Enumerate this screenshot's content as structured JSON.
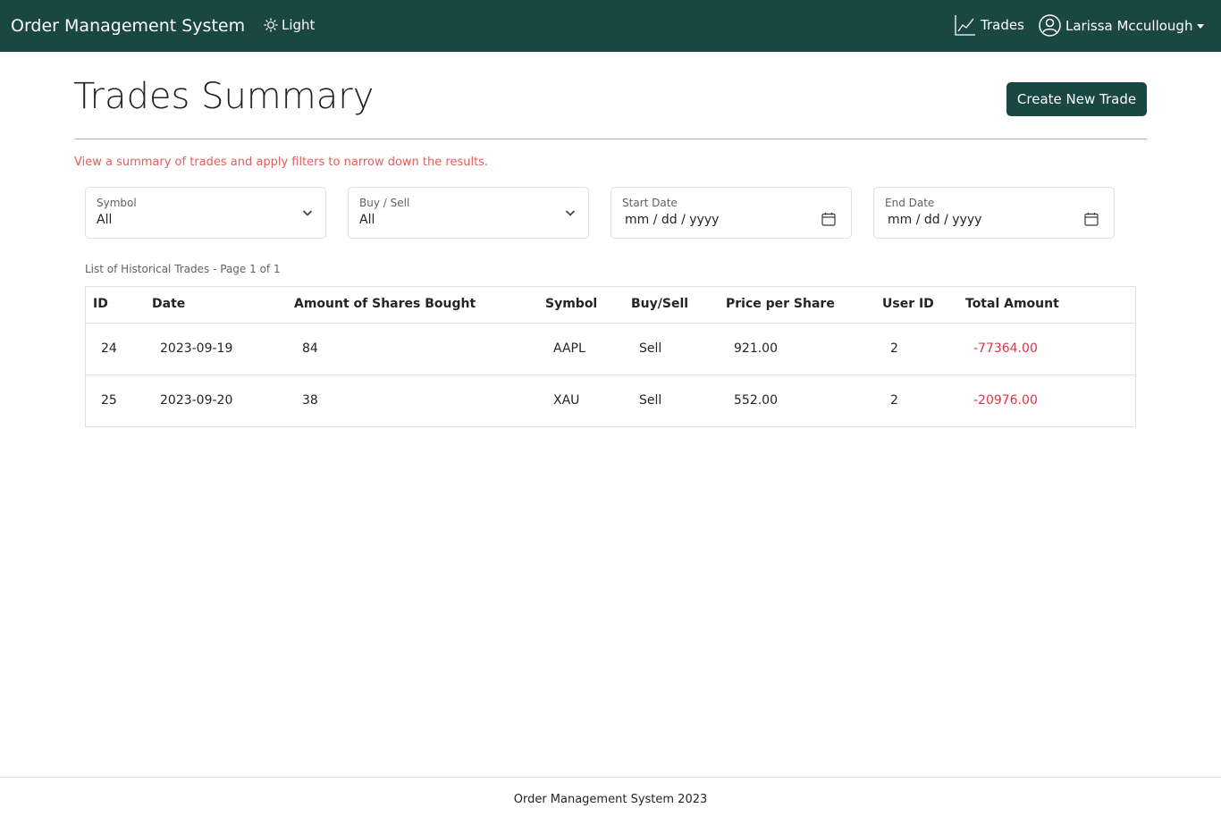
{
  "navbar": {
    "brand": "Order Management System",
    "theme_label": "Light",
    "trades_label": "Trades",
    "user_name": "Larissa Mccullough"
  },
  "header": {
    "title": "Trades Summary",
    "create_button": "Create New Trade",
    "subtitle": "View a summary of trades and apply filters to narrow down the results."
  },
  "filters": {
    "symbol": {
      "label": "Symbol",
      "value": "All"
    },
    "buy_sell": {
      "label": "Buy / Sell",
      "value": "All"
    },
    "start_date": {
      "label": "Start Date",
      "placeholder": "mm / dd / yyyy"
    },
    "end_date": {
      "label": "End Date",
      "placeholder": "mm / dd / yyyy"
    }
  },
  "table": {
    "caption": "List of Historical Trades - Page 1 of 1",
    "headers": [
      "ID",
      "Date",
      "Amount of Shares Bought",
      "Symbol",
      "Buy/Sell",
      "Price per Share",
      "User ID",
      "Total Amount"
    ],
    "rows": [
      [
        "24",
        "2023-09-19",
        "84",
        "AAPL",
        "Sell",
        "921.00",
        "2",
        "-77364.00"
      ],
      [
        "25",
        "2023-09-20",
        "38",
        "XAU",
        "Sell",
        "552.00",
        "2",
        "-20976.00"
      ]
    ]
  },
  "footer": {
    "text": "Order Management System 2023"
  },
  "colors": {
    "navbar": "#1a4744",
    "button": "#1a4744",
    "subtitle": "#e35d5d",
    "negative": "#dc3545"
  },
  "icons": {
    "theme": "sun-icon",
    "trades": "chart-line-icon",
    "user": "user-circle-icon",
    "select": "chevron-down-icon",
    "date": "calendar-icon"
  }
}
